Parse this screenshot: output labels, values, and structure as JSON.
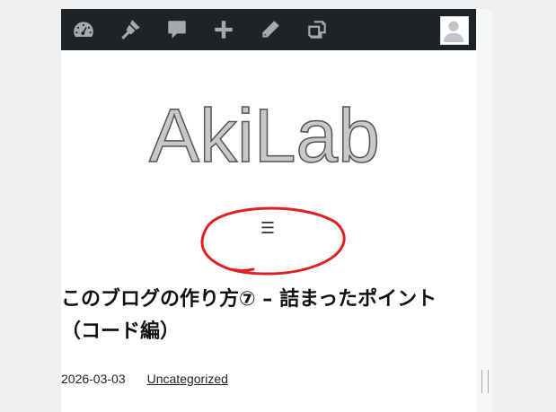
{
  "admin_bar": {
    "items": [
      {
        "icon": "dashboard-icon"
      },
      {
        "icon": "customize-icon"
      },
      {
        "icon": "comments-icon"
      },
      {
        "icon": "new-content-icon"
      },
      {
        "icon": "edit-icon"
      },
      {
        "icon": "duplicate-icon"
      }
    ],
    "avatar": {
      "icon": "user-avatar-icon"
    }
  },
  "site": {
    "logo_text": "AkiLab"
  },
  "nav": {
    "menu_toggle": "☰"
  },
  "post": {
    "title": "このブログの作り方⑦ – 詰まったポイント（コード編）",
    "date": "2026-03-03",
    "category": "Uncategorized"
  },
  "colors": {
    "admin_bar_bg": "#1d2327",
    "admin_icon": "#a7aaad",
    "annotation": "#e02020",
    "logo_fill": "#c8c8c8"
  }
}
